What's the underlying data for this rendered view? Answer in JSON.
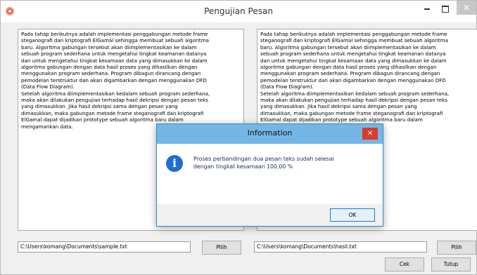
{
  "window": {
    "title": "Pengujian Pesan",
    "close_glyph": "✕"
  },
  "left_panel": {
    "text": "Pada tahap berikutnya adalah implementasi penggabungan metode frame\nsteganografi dan kriptografi ElGamal sehingga membuat sebuah algoritma\nbaru. Algoritma gabungan tersebut akan diimplementasikan ke dalam\nsebuah program sederhana untuk mengetahui tingkat keamanan datanya\ndan untuk mengetahui tingkat kesamaan data yang dimasukkan ke dalam\nalgoritma gabungan dengan data hasil proses yang dihasilkan dengan\nmenggunakan program sederhana. Program dibagun dirancang dengan\npemodelan terstruktur dan akan digambarkan dengan menggunakan DFD\n(Data Flow Diagram).\nSetelah algoritma diimplementasikan kedalam sebuah program sederhana,\nmaka akan dilakukan pengujian terhadap hasil dekripsi dengan pesan teks\nyang dimasukkan. Jika hasil dekripsi sama dengan pesan yang\ndimasukkan, maka gabungan metode frame steganografi dan kriptografi\nElGamal dapat dijadikan prototype sebuah algoritma baru dalam\nmengamankan data.",
    "path": "C:\\Users\\komang\\Documents\\sample.txt",
    "pilih_label": "Pilih"
  },
  "right_panel": {
    "text": "Pada tahap berikutnya adalah implementasi penggabungan metode frame\nsteganografi dan kriptografi ElGamal sehingga membuat sebuah algoritma\nbaru. Algoritma gabungan tersebut akan diimplementasikan ke dalam\nsebuah program sederhana untuk mengetahui tingkat keamanan datanya\ndan untuk mengetahui tingkat kesamaan data yang dimasukkan ke dalam\nalgoritma gabungan dengan data hasil proses yang dihasilkan dengan\nmenggunakan program sederhana. Program dibagun dirancang dengan\npemodelan terstruktur dan akan digambarkan dengan menggunakan DFD\n(Data Flow Diagram).\nSetelah algoritma diimplementasikan kedalam sebuah program sederhana,\nmaka akan dilakukan pengujian terhadap hasil dekripsi dengan pesan teks\nyang dimasukkan. Jika hasil dekripsi sama dengan pesan yang\ndimasukkan, maka gabungan metode frame steganografi dan kriptografi\nElGamal dapat dijadikan prototype sebuah algoritma baru dalam\nmengamankan data.",
    "path": "C:\\Users\\komang\\Documents\\hasil.txt",
    "pilih_label": "Pilih"
  },
  "footer": {
    "cek_label": "Cek",
    "tutup_label": "Tutup"
  },
  "dialog": {
    "title": "Information",
    "message": "Proses perbandingan dua pesan teks sudah selesai\ndengan tingkat kesamaan 100,00 %",
    "ok_label": "OK",
    "close_glyph": "✕",
    "icon_glyph": "i"
  },
  "colors": {
    "dialog_titlebar": "#74b6e6",
    "dialog_close": "#d93b2b",
    "info_icon": "#1c6fd1"
  }
}
